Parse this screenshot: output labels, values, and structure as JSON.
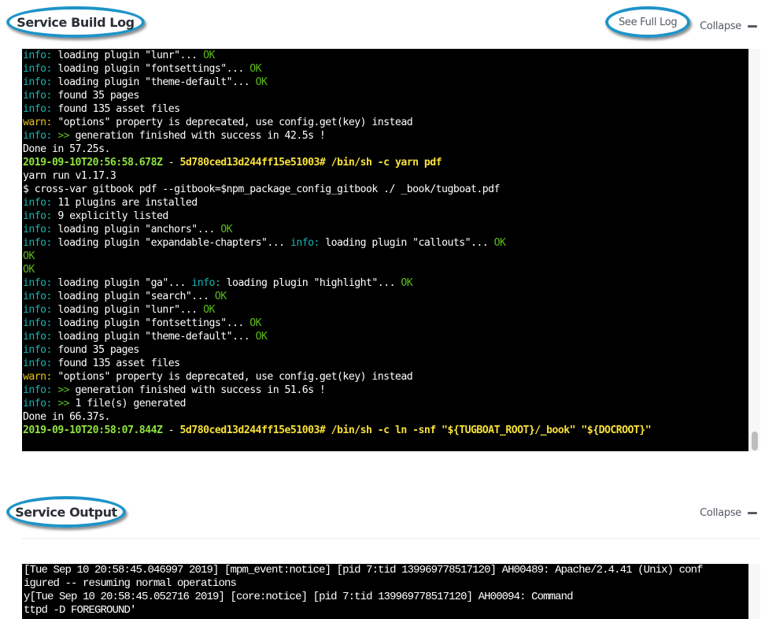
{
  "build_log": {
    "title": "Service Build Log",
    "see_full_log_label": "See Full Log",
    "collapse_label": "Collapse",
    "lines": [
      [
        {
          "t": "info:",
          "c": "info"
        },
        {
          "t": " loading plugin \"lunr\"... "
        },
        {
          "t": "OK",
          "c": "ok"
        }
      ],
      [
        {
          "t": "info:",
          "c": "info"
        },
        {
          "t": " loading plugin \"fontsettings\"... "
        },
        {
          "t": "OK",
          "c": "ok"
        }
      ],
      [
        {
          "t": "info:",
          "c": "info"
        },
        {
          "t": " loading plugin \"theme-default\"... "
        },
        {
          "t": "OK",
          "c": "ok"
        }
      ],
      [
        {
          "t": "info:",
          "c": "info"
        },
        {
          "t": " found 35 pages"
        }
      ],
      [
        {
          "t": "info:",
          "c": "info"
        },
        {
          "t": " found 135 asset files"
        }
      ],
      [
        {
          "t": "warn:",
          "c": "warn"
        },
        {
          "t": " \"options\" property is deprecated, use config.get(key) instead"
        }
      ],
      [
        {
          "t": "info:",
          "c": "info"
        },
        {
          "t": " "
        },
        {
          "t": ">>",
          "c": "arrow"
        },
        {
          "t": " generation finished with success in 42.5s !"
        }
      ],
      [
        {
          "t": "Done in 57.25s."
        }
      ],
      [
        {
          "t": "2019-09-10T20:56:58.678Z",
          "c": "ts"
        },
        {
          "t": " - "
        },
        {
          "t": "5d780ced13d244ff15e51003# /bin/sh -c yarn pdf",
          "c": "cmd"
        }
      ],
      [
        {
          "t": "yarn run v1.17.3"
        }
      ],
      [
        {
          "t": "$ cross-var gitbook pdf --gitbook=$npm_package_config_gitbook ./ _book/tugboat.pdf"
        }
      ],
      [
        {
          "t": "info:",
          "c": "info"
        },
        {
          "t": " 11 plugins are installed"
        }
      ],
      [
        {
          "t": "info:",
          "c": "info"
        },
        {
          "t": " 9 explicitly listed"
        }
      ],
      [
        {
          "t": "info:",
          "c": "info"
        },
        {
          "t": " loading plugin \"anchors\"... "
        },
        {
          "t": "OK",
          "c": "ok"
        }
      ],
      [
        {
          "t": "info:",
          "c": "info"
        },
        {
          "t": " loading plugin \"expandable-chapters\"... "
        },
        {
          "t": "info:",
          "c": "info"
        },
        {
          "t": " loading plugin \"callouts\"... "
        },
        {
          "t": "OK",
          "c": "ok"
        }
      ],
      [
        {
          "t": "OK",
          "c": "ok"
        }
      ],
      [
        {
          "t": "OK",
          "c": "ok"
        }
      ],
      [
        {
          "t": "info:",
          "c": "info"
        },
        {
          "t": " loading plugin \"ga\"... "
        },
        {
          "t": "info:",
          "c": "info"
        },
        {
          "t": " loading plugin \"highlight\"... "
        },
        {
          "t": "OK",
          "c": "ok"
        }
      ],
      [
        {
          "t": "info:",
          "c": "info"
        },
        {
          "t": " loading plugin \"search\"... "
        },
        {
          "t": "OK",
          "c": "ok"
        }
      ],
      [
        {
          "t": "info:",
          "c": "info"
        },
        {
          "t": " loading plugin \"lunr\"... "
        },
        {
          "t": "OK",
          "c": "ok"
        }
      ],
      [
        {
          "t": "info:",
          "c": "info"
        },
        {
          "t": " loading plugin \"fontsettings\"... "
        },
        {
          "t": "OK",
          "c": "ok"
        }
      ],
      [
        {
          "t": "info:",
          "c": "info"
        },
        {
          "t": " loading plugin \"theme-default\"... "
        },
        {
          "t": "OK",
          "c": "ok"
        }
      ],
      [
        {
          "t": "info:",
          "c": "info"
        },
        {
          "t": " found 35 pages"
        }
      ],
      [
        {
          "t": "info:",
          "c": "info"
        },
        {
          "t": " found 135 asset files"
        }
      ],
      [
        {
          "t": "warn:",
          "c": "warn"
        },
        {
          "t": " \"options\" property is deprecated, use config.get(key) instead"
        }
      ],
      [
        {
          "t": "info:",
          "c": "info"
        },
        {
          "t": " "
        },
        {
          "t": ">>",
          "c": "arrow"
        },
        {
          "t": " generation finished with success in 51.6s !"
        }
      ],
      [
        {
          "t": "info:",
          "c": "info"
        },
        {
          "t": " "
        },
        {
          "t": ">>",
          "c": "arrow"
        },
        {
          "t": " 1 file(s) generated"
        }
      ],
      [
        {
          "t": "Done in 66.37s."
        }
      ],
      [
        {
          "t": "2019-09-10T20:58:07.844Z",
          "c": "ts"
        },
        {
          "t": " - "
        },
        {
          "t": "5d780ced13d244ff15e51003# /bin/sh -c ln -snf \"${TUGBOAT_ROOT}/_book\" \"${DOCROOT}\"",
          "c": "cmd"
        }
      ]
    ]
  },
  "service_output": {
    "title": "Service Output",
    "collapse_label": "Collapse",
    "lines": [
      "[Tue Sep 10 20:58:45.046997 2019] [mpm_event:notice] [pid 7:tid 139969778517120] AH00489: Apache/2.4.41 (Unix) conf",
      "igured -- resuming normal operations",
      "y[Tue Sep 10 20:58:45.052716 2019] [core:notice] [pid 7:tid 139969778517120] AH00094: Command",
      "ttpd -D FOREGROUND'"
    ]
  }
}
